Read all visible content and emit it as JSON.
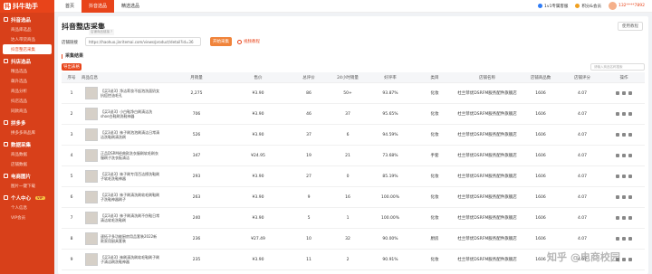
{
  "app": {
    "logo_text": "抖牛助手",
    "nav": [
      "首页",
      "抖音选品",
      "精选选品"
    ],
    "nav_active": 1
  },
  "topright": {
    "monitor": "1v1专属客服",
    "points": "积分&会员",
    "phone": "132****7892"
  },
  "sidebar": {
    "groups": [
      {
        "title": "抖音选品",
        "items": [
          "商品库选品",
          "达人带货商品",
          "抖音整店采集"
        ]
      },
      {
        "title": "抖店选品",
        "items": [
          "精品选品",
          "飙升选品",
          "商品分析",
          "抖店选品",
          "同款商品"
        ]
      },
      {
        "title": "拼多多",
        "items": [
          "拼多多商品库"
        ]
      },
      {
        "title": "数据采集",
        "items": [
          "商品数据",
          "店铺数据"
        ]
      },
      {
        "title": "电商图片",
        "items": [
          "图片一键下载"
        ]
      },
      {
        "title": "个人中心",
        "items": [
          "个人信息",
          "VIP会员"
        ]
      }
    ],
    "vip_tag": "VIP"
  },
  "page": {
    "title": "抖音整店采集",
    "help_label": "使用教程",
    "shop_label": "店铺链接",
    "url_hint": "店铺商品链接 ?",
    "url_value": "https://haohuo.jinritemai.com/views/product/detail?id=36",
    "collect_label": "开始采集",
    "video_label": "视频教程",
    "result_title": "采集结果",
    "export_label": "导出表格",
    "search_placeholder": "请输入商品名称搜索"
  },
  "table": {
    "headers": [
      "序号",
      "商品信息",
      "月销量",
      "售价",
      "总评价",
      "24小时销量",
      "好评率",
      "类目",
      "店铺名称",
      "店铺商品数",
      "店铺评分",
      "操作"
    ],
    "rows": [
      [
        "1",
        "【买3送3】净洁莉妆不起泡洗面奶女抗痘控油毛孔",
        "2,275",
        "¥3.90",
        "86",
        "50+",
        "93.87%",
        "化妆",
        "杜兰菲优DSRFM服务配件旗舰店",
        "1606",
        "4.07"
      ],
      [
        "2",
        "【买3送3】小白鞋净白刷清洁洗shoe白鞋刷洗鞋神器",
        "706",
        "¥3.90",
        "46",
        "37",
        "95.65%",
        "化妆",
        "杜兰菲优DSRFM服务配件旗舰店",
        "1606",
        "4.07"
      ],
      [
        "3",
        "【买3送3】袜子刷泡泡刷清洁日常清洁洗鞋刷清洗刷",
        "526",
        "¥3.90",
        "37",
        "6",
        "94.59%",
        "化妆",
        "杜兰菲优DSRFM服务配件旗舰店",
        "1606",
        "4.07"
      ],
      [
        "4",
        "正品DSRM经典款洗衣服刷软毛刷衣服刷子洗衣板清洁",
        "347",
        "¥24.95",
        "19",
        "21",
        "73.68%",
        "手套",
        "杜兰菲优DSRFM服务配件旗舰店",
        "1606",
        "4.07"
      ],
      [
        "5",
        "【买3送3】袜子刷专用百洁擦洗鞋刷子软毛洗鞋神器",
        "293",
        "¥3.90",
        "27",
        "0",
        "85.19%",
        "化妆",
        "杜兰菲优DSRFM服务配件旗舰店",
        "1606",
        "4.07"
      ],
      [
        "6",
        "【买3送3】袜子刷清洗刷软毛刷鞋刷子洗鞋神器刷子",
        "263",
        "¥3.90",
        "9",
        "16",
        "100.00%",
        "化妆",
        "杜兰菲优DSRFM服务配件旗舰店",
        "1606",
        "4.07"
      ],
      [
        "7",
        "【买3送3】袜子刷清洗刷不伤鞋日常清洁软毛洗鞋刷",
        "240",
        "¥3.90",
        "5",
        "1",
        "100.00%",
        "化妆",
        "杜兰菲优DSRFM服务配件旗舰店",
        "1606",
        "4.07"
      ],
      [
        "8",
        "速拓子多功能厨房用品套装2022新款家用厨具套装",
        "236",
        "¥27.49",
        "10",
        "32",
        "90.00%",
        "厨房",
        "杜兰菲优DSRFM服务配件旗舰店",
        "1606",
        "4.07"
      ],
      [
        "9",
        "【买3送3】袜刷清洗刷软毛鞋刷子刷子清洁刷洗鞋神器",
        "235",
        "¥3.90",
        "11",
        "2",
        "90.91%",
        "化妆",
        "杜兰菲优DSRFM服务配件旗舰店",
        "1606",
        "4.07"
      ]
    ]
  },
  "watermark": "知乎 @电商校园"
}
